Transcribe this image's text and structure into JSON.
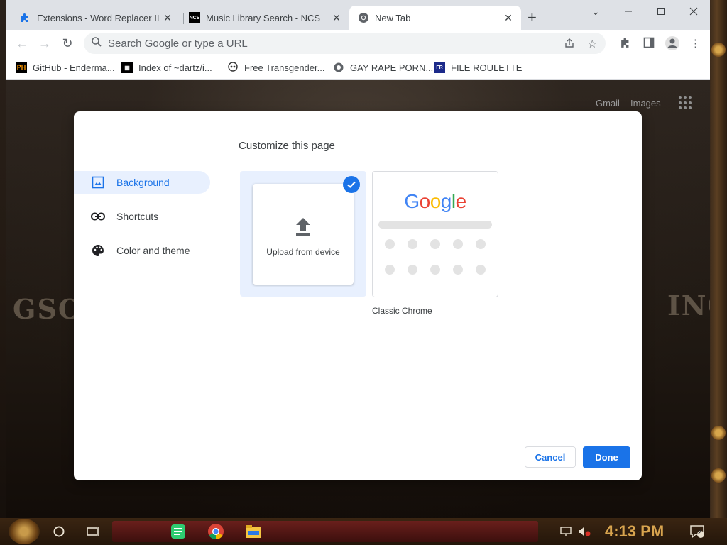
{
  "tabs": [
    {
      "title": "Extensions - Word Replacer II",
      "favicon": "puzzle-icon"
    },
    {
      "title": "Music Library Search - NCS",
      "favicon": "ncs-logo"
    },
    {
      "title": "New Tab",
      "favicon": "chrome-icon"
    }
  ],
  "omnibox": {
    "placeholder": "Search Google or type a URL"
  },
  "bookmarks": [
    {
      "label": "GitHub - Enderma...",
      "favicon": "ph-logo"
    },
    {
      "label": "Index of ~dartz/i...",
      "favicon": "qr-logo"
    },
    {
      "label": "Free Transgender...",
      "favicon": "skull-logo"
    },
    {
      "label": "GAY RAPE PORN...",
      "favicon": "globe-icon"
    },
    {
      "label": "FILE ROULETTE",
      "favicon": "fr-logo"
    }
  ],
  "ntp": {
    "gmail": "Gmail",
    "images": "Images",
    "bg_left": "GSO",
    "bg_right": "INC"
  },
  "dialog": {
    "title": "Customize this page",
    "sidebar": [
      {
        "label": "Background",
        "selected": true
      },
      {
        "label": "Shortcuts",
        "selected": false
      },
      {
        "label": "Color and theme",
        "selected": false
      }
    ],
    "upload_label": "Upload from device",
    "classic_label": "Classic Chrome",
    "cancel": "Cancel",
    "done": "Done"
  },
  "taskbar": {
    "time": "4:13 PM",
    "notifications": "2"
  },
  "colors": {
    "accent": "#1a73e8",
    "selected_bg": "#e8f0fe"
  }
}
